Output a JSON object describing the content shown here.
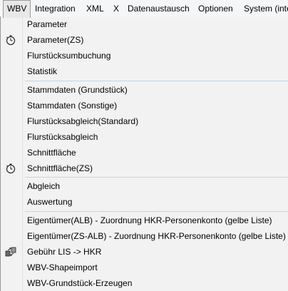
{
  "menubar": {
    "items": [
      "WBV",
      "Integration",
      "XML",
      "X",
      "Datenaustausch",
      "Optionen",
      "System (inte"
    ]
  },
  "menu": {
    "groups": [
      [
        "Parameter",
        "Parameter(ZS)",
        "Flurstücksumbuchung",
        "Statistik"
      ],
      [
        "Stammdaten (Grundstück)",
        "Stammdaten (Sonstige)",
        "Flurstücksabgleich(Standard)",
        "Flurstücksabgleich",
        "Schnittfläche",
        "Schnittfläche(ZS)"
      ],
      [
        "Abgleich",
        "Auswertung"
      ],
      [
        "Eigentümer(ALB) - Zuordnung HKR-Personenkonto (gelbe Liste)",
        "Eigentümer(ZS-ALB) - Zuordnung HKR-Personenkonto (gelbe Liste)",
        "Gebühr LIS -> HKR",
        "WBV-Shapeimport",
        "WBV-Grundstück-Erzeugen"
      ]
    ],
    "icons": {
      "parameter_zs": "stopwatch-icon",
      "schnittflaeche_zs": "stopwatch-icon",
      "gebuehr_lis_hkr": "transfer-icon"
    }
  }
}
